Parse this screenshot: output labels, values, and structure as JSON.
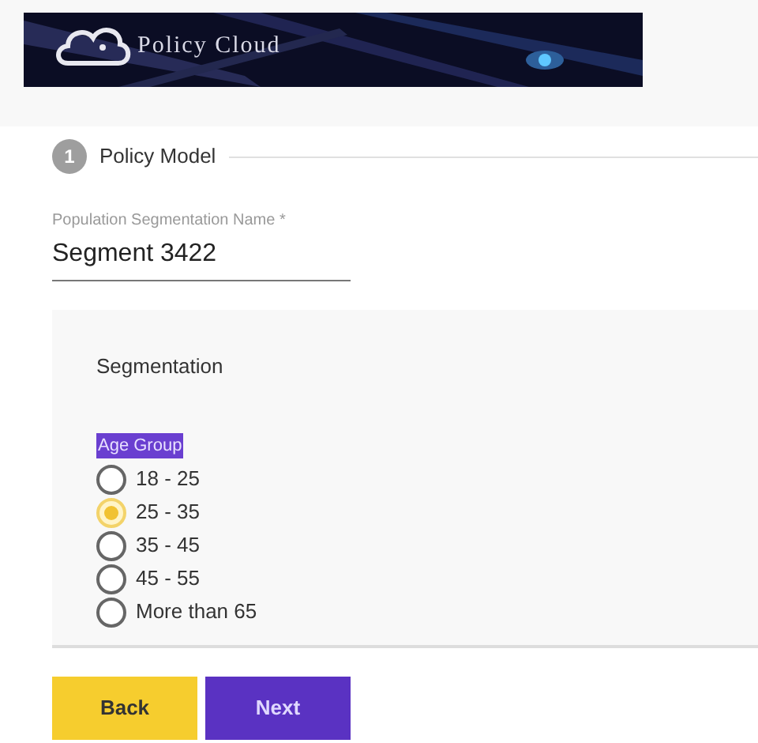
{
  "header": {
    "brand": "Policy Cloud"
  },
  "stepper": {
    "number": "1",
    "label": "Policy Model"
  },
  "name_field": {
    "label": "Population Segmentation Name *",
    "value": "Segment 3422"
  },
  "segmentation": {
    "title": "Segmentation",
    "group_label": "Age Group",
    "options": [
      {
        "label": "18 - 25",
        "selected": false
      },
      {
        "label": "25 - 35",
        "selected": true
      },
      {
        "label": "35 - 45",
        "selected": false
      },
      {
        "label": "45 - 55",
        "selected": false
      },
      {
        "label": "More than 65",
        "selected": false
      }
    ]
  },
  "buttons": [
    {
      "label": "Back",
      "kind": "secondary"
    },
    {
      "label": "Next",
      "kind": "primary"
    }
  ]
}
